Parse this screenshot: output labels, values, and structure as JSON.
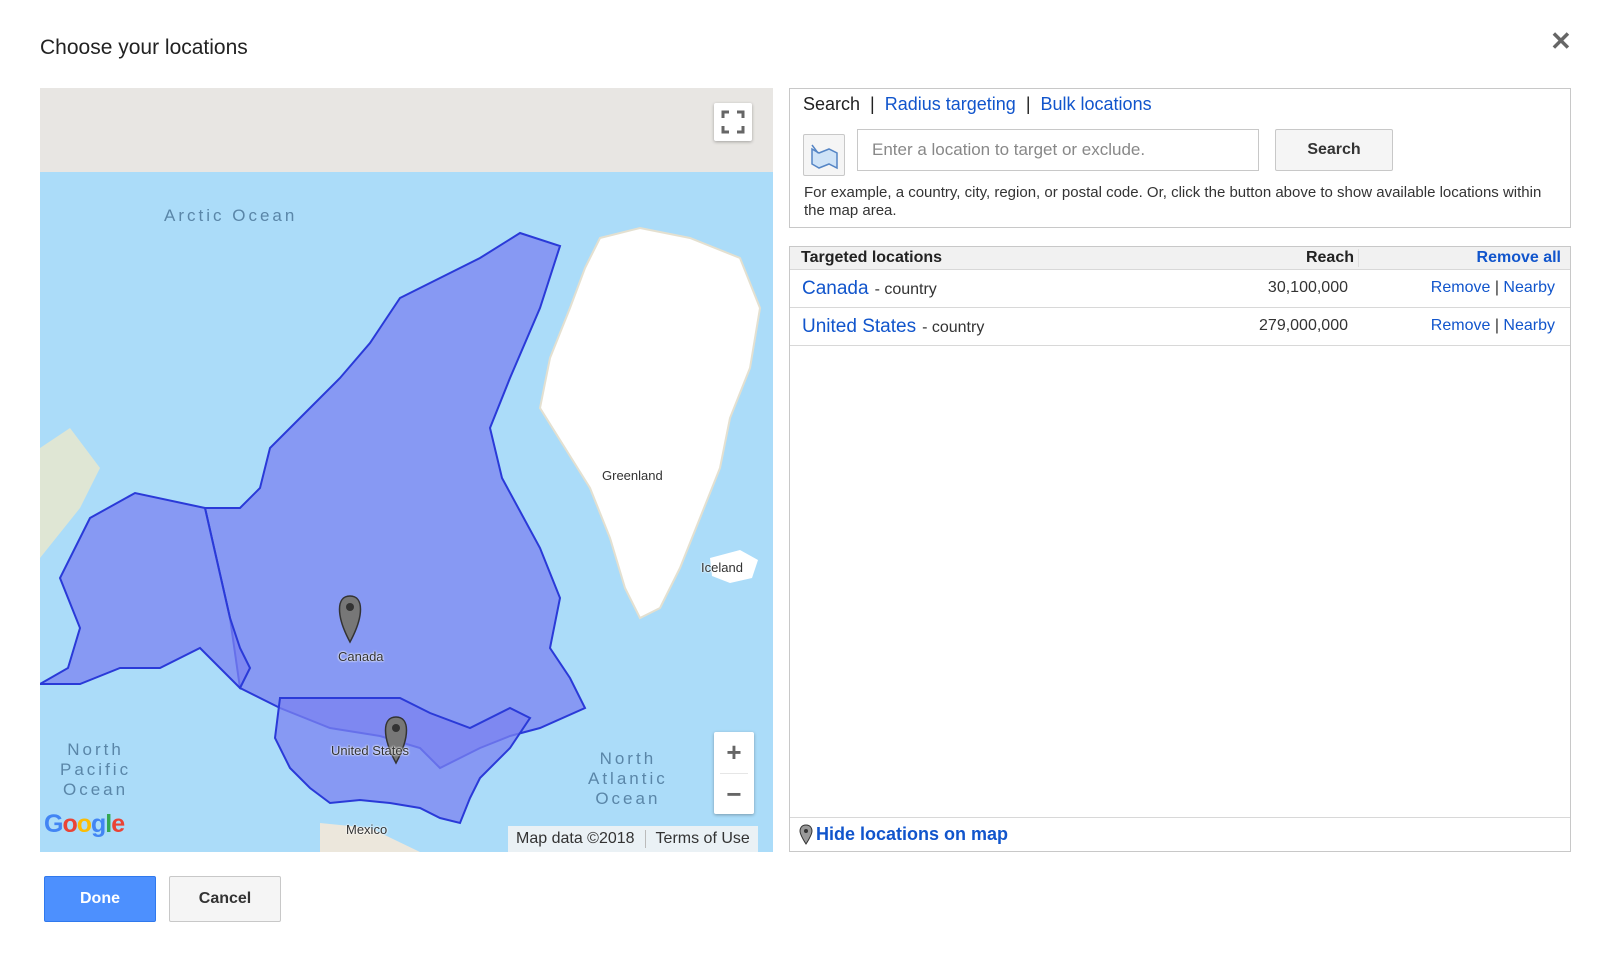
{
  "dialog": {
    "title": "Choose your locations"
  },
  "map": {
    "labels": {
      "arctic": "Arctic Ocean",
      "greenland": "Greenland",
      "iceland": "Iceland",
      "canada": "Canada",
      "united_states": "United States",
      "mexico": "Mexico",
      "north_pacific": [
        "North",
        "Pacific",
        "Ocean"
      ],
      "north_atlantic": [
        "North",
        "Atlantic",
        "Ocean"
      ]
    },
    "footer": {
      "map_data": "Map data ©2018",
      "terms": "Terms of Use"
    },
    "logo_text": "Google",
    "controls": {
      "zoom_in": "+",
      "zoom_out": "−"
    },
    "colors": {
      "ocean": "#abdcf9",
      "selection_fill": "#7b83f0",
      "selection_stroke": "#2a3ad8",
      "greenland": "#ffffff"
    }
  },
  "search": {
    "tabs": {
      "search": "Search",
      "radius": "Radius targeting",
      "bulk": "Bulk locations",
      "separator": "|"
    },
    "input_placeholder": "Enter a location to target or exclude.",
    "button": "Search",
    "help_text": "For example, a country, city, region, or postal code. Or, click the button above to show available locations within the map area."
  },
  "targets": {
    "header": {
      "name": "Targeted locations",
      "reach": "Reach",
      "remove_all": "Remove all"
    },
    "rows": [
      {
        "name": "Canada",
        "type": "- country",
        "reach": "30,100,000",
        "remove": "Remove",
        "sep": "|",
        "nearby": "Nearby"
      },
      {
        "name": "United States",
        "type": "- country",
        "reach": "279,000,000",
        "remove": "Remove",
        "sep": "|",
        "nearby": "Nearby"
      }
    ],
    "footer_link": "Hide locations on map"
  },
  "actions": {
    "done": "Done",
    "cancel": "Cancel"
  }
}
